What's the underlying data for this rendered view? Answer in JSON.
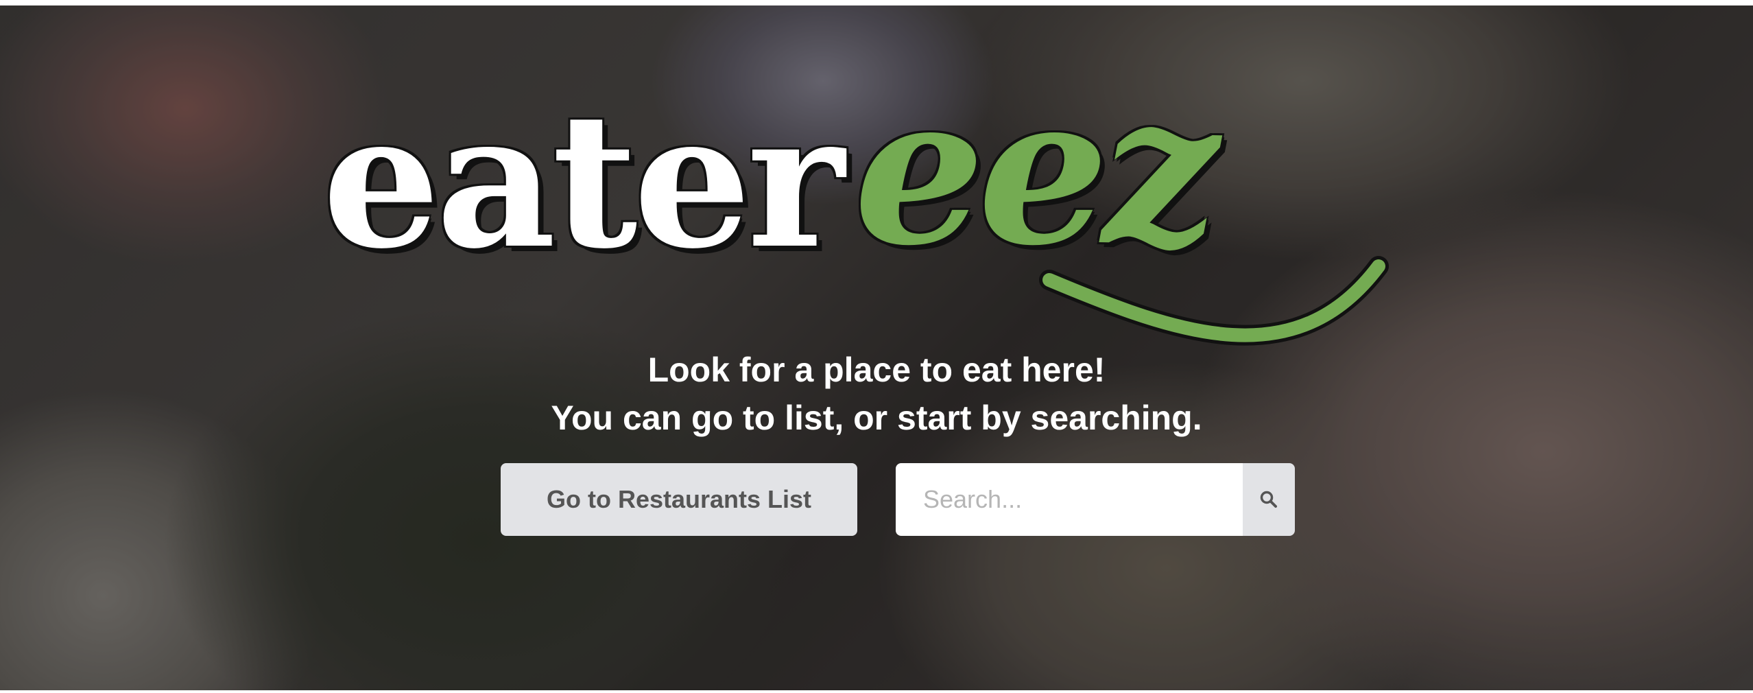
{
  "logo": {
    "word_part1": "eater",
    "word_part2": "eez",
    "accent_color": "#74ab52"
  },
  "hero": {
    "line1": "Look for a place to eat here!",
    "line2": "You can go to list, or start by searching."
  },
  "actions": {
    "list_button_label": "Go to Restaurants List"
  },
  "search": {
    "placeholder": "Search...",
    "value": "",
    "button_icon": "search-icon"
  }
}
